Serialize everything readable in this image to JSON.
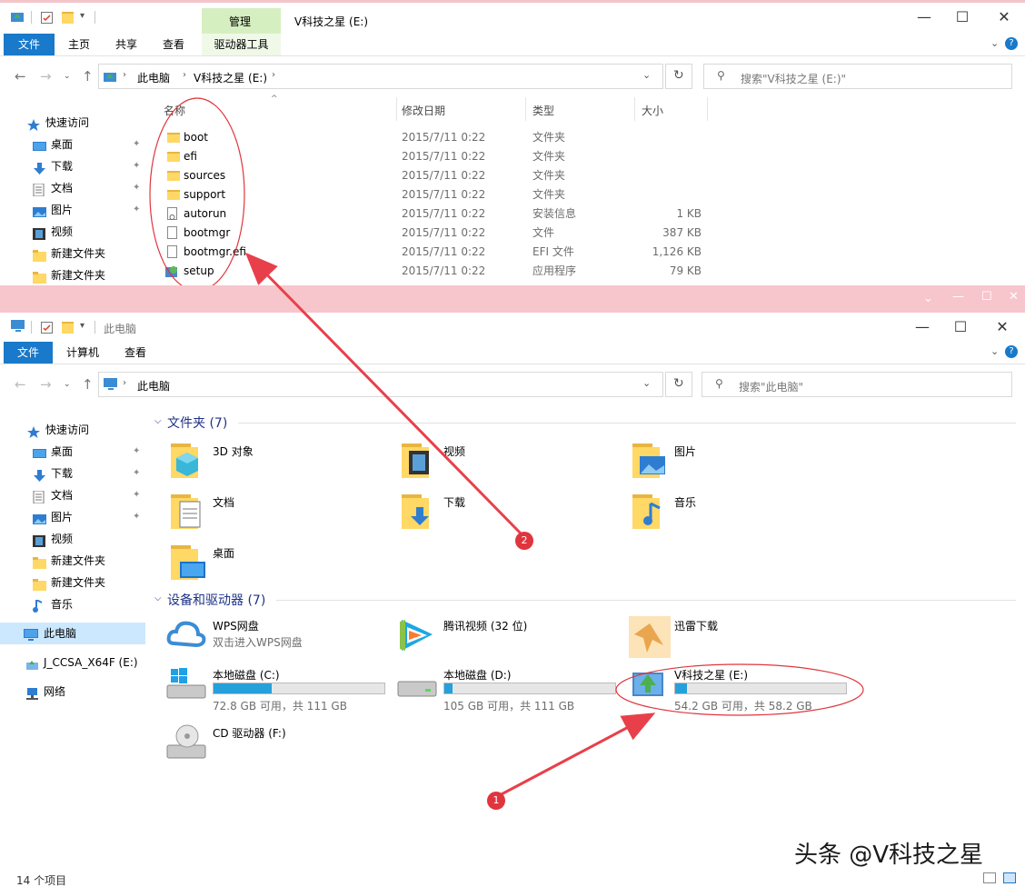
{
  "window1": {
    "title": "V科技之星 (E:)",
    "ctx_tab_group": "管理",
    "tabs": [
      "文件",
      "主页",
      "共享",
      "查看",
      "驱动器工具"
    ],
    "address": [
      "此电脑",
      "V科技之星 (E:)"
    ],
    "search_placeholder": "搜索\"V科技之星 (E:)\"",
    "columns": {
      "name": "名称",
      "date": "修改日期",
      "type": "类型",
      "size": "大小"
    },
    "nav": [
      {
        "label": "快速访问",
        "icon": "star-icon"
      },
      {
        "label": "桌面",
        "icon": "desktop-icon",
        "pinned": true
      },
      {
        "label": "下载",
        "icon": "download-icon",
        "pinned": true
      },
      {
        "label": "文档",
        "icon": "document-icon",
        "pinned": true
      },
      {
        "label": "图片",
        "icon": "picture-icon",
        "pinned": true
      },
      {
        "label": "视频",
        "icon": "video-icon"
      },
      {
        "label": "新建文件夹",
        "icon": "folder-icon"
      },
      {
        "label": "新建文件夹",
        "icon": "folder-icon"
      }
    ],
    "files": [
      {
        "name": "boot",
        "date": "2015/7/11 0:22",
        "type": "文件夹",
        "size": "",
        "icon": "folder-icon"
      },
      {
        "name": "efi",
        "date": "2015/7/11 0:22",
        "type": "文件夹",
        "size": "",
        "icon": "folder-icon"
      },
      {
        "name": "sources",
        "date": "2015/7/11 0:22",
        "type": "文件夹",
        "size": "",
        "icon": "folder-icon"
      },
      {
        "name": "support",
        "date": "2015/7/11 0:22",
        "type": "文件夹",
        "size": "",
        "icon": "folder-icon"
      },
      {
        "name": "autorun",
        "date": "2015/7/11 0:22",
        "type": "安装信息",
        "size": "1 KB",
        "icon": "settings-file-icon"
      },
      {
        "name": "bootmgr",
        "date": "2015/7/11 0:22",
        "type": "文件",
        "size": "387 KB",
        "icon": "file-icon"
      },
      {
        "name": "bootmgr.efi",
        "date": "2015/7/11 0:22",
        "type": "EFI 文件",
        "size": "1,126 KB",
        "icon": "file-icon"
      },
      {
        "name": "setup",
        "date": "2015/7/11 0:22",
        "type": "应用程序",
        "size": "79 KB",
        "icon": "setup-icon"
      }
    ]
  },
  "window2": {
    "title": "此电脑",
    "tabs": [
      "文件",
      "计算机",
      "查看"
    ],
    "address": [
      "此电脑"
    ],
    "search_placeholder": "搜索\"此电脑\"",
    "nav": [
      {
        "label": "快速访问",
        "icon": "star-icon"
      },
      {
        "label": "桌面",
        "icon": "desktop-icon",
        "pinned": true
      },
      {
        "label": "下载",
        "icon": "download-icon",
        "pinned": true
      },
      {
        "label": "文档",
        "icon": "document-icon",
        "pinned": true
      },
      {
        "label": "图片",
        "icon": "picture-icon",
        "pinned": true
      },
      {
        "label": "视频",
        "icon": "video-icon"
      },
      {
        "label": "新建文件夹",
        "icon": "folder-icon"
      },
      {
        "label": "新建文件夹",
        "icon": "folder-icon"
      },
      {
        "label": "音乐",
        "icon": "music-icon"
      },
      {
        "label": "此电脑",
        "icon": "computer-icon",
        "selected": true
      },
      {
        "label": "J_CCSA_X64F (E:)",
        "icon": "usb-drive-icon"
      },
      {
        "label": "网络",
        "icon": "network-icon"
      }
    ],
    "folders_header": "文件夹 (7)",
    "folders": [
      {
        "label": "3D 对象",
        "icon": "3d-objects-icon"
      },
      {
        "label": "视频",
        "icon": "videos-folder-icon"
      },
      {
        "label": "图片",
        "icon": "pictures-folder-icon"
      },
      {
        "label": "文档",
        "icon": "documents-folder-icon"
      },
      {
        "label": "下载",
        "icon": "downloads-folder-icon"
      },
      {
        "label": "音乐",
        "icon": "music-folder-icon"
      },
      {
        "label": "桌面",
        "icon": "desktop-folder-icon"
      }
    ],
    "devices_header": "设备和驱动器 (7)",
    "devices": [
      {
        "label": "WPS网盘",
        "sub": "双击进入WPS网盘",
        "icon": "wps-cloud-icon"
      },
      {
        "label": "腾讯视频 (32 位)",
        "icon": "tencent-video-icon"
      },
      {
        "label": "迅雷下载",
        "icon": "xunlei-icon"
      },
      {
        "label": "本地磁盘 (C:)",
        "usage": "72.8 GB 可用，共 111 GB",
        "fill": 0.34,
        "icon": "windows-drive-icon"
      },
      {
        "label": "本地磁盘 (D:)",
        "usage": "105 GB 可用，共 111 GB",
        "fill": 0.05,
        "icon": "hard-drive-icon"
      },
      {
        "label": "V科技之星 (E:)",
        "usage": "54.2 GB 可用，共 58.2 GB",
        "fill": 0.07,
        "icon": "usb-drive-icon"
      },
      {
        "label": "CD 驱动器 (F:)",
        "icon": "cd-drive-icon"
      }
    ],
    "status": "14 个项目"
  },
  "annotations": [
    "1",
    "2"
  ],
  "watermark": "头条 @V科技之星",
  "colors": {
    "accent": "#1979ca",
    "context_tab": "#d6efc0",
    "pink": "#f7c6cc",
    "annotation_red": "#e0353d",
    "drive_fill": "#26a0da"
  }
}
